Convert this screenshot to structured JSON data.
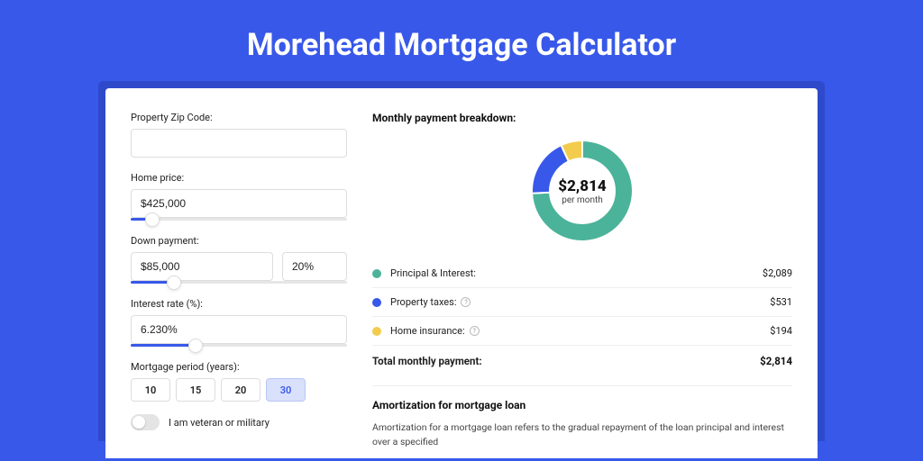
{
  "title": "Morehead Mortgage Calculator",
  "form": {
    "zip": {
      "label": "Property Zip Code:",
      "value": ""
    },
    "homePrice": {
      "label": "Home price:",
      "value": "$425,000",
      "sliderPct": 10
    },
    "downPayment": {
      "label": "Down payment:",
      "value": "$85,000",
      "pct": "20%",
      "sliderPct": 20
    },
    "interestRate": {
      "label": "Interest rate (%):",
      "value": "6.230%",
      "sliderPct": 30
    },
    "period": {
      "label": "Mortgage period (years):",
      "options": [
        "10",
        "15",
        "20",
        "30"
      ],
      "selected": "30"
    },
    "veteran": {
      "label": "I am veteran or military",
      "checked": false
    }
  },
  "breakdown": {
    "title": "Monthly payment breakdown:",
    "donut": {
      "amount": "$2,814",
      "sub": "per month"
    },
    "items": [
      {
        "label": "Principal & Interest:",
        "value": "$2,089",
        "color": "#4bb39a"
      },
      {
        "label": "Property taxes:",
        "value": "$531",
        "color": "#3858e9",
        "info": true
      },
      {
        "label": "Home insurance:",
        "value": "$194",
        "color": "#f3cc4e",
        "info": true
      }
    ],
    "total": {
      "label": "Total monthly payment:",
      "value": "$2,814"
    }
  },
  "amortization": {
    "title": "Amortization for mortgage loan",
    "text": "Amortization for a mortgage loan refers to the gradual repayment of the loan principal and interest over a specified"
  },
  "chart_data": {
    "type": "pie",
    "title": "Monthly payment breakdown",
    "series": [
      {
        "name": "Principal & Interest",
        "value": 2089,
        "color": "#4bb39a"
      },
      {
        "name": "Property taxes",
        "value": 531,
        "color": "#3858e9"
      },
      {
        "name": "Home insurance",
        "value": 194,
        "color": "#f3cc4e"
      }
    ],
    "total": 2814
  }
}
